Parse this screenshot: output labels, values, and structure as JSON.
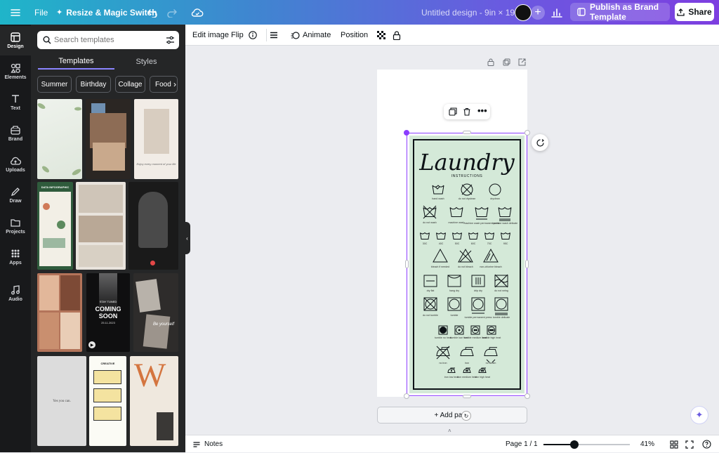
{
  "topbar": {
    "file_label": "File",
    "resize_label": "Resize & Magic Switch",
    "doc_title": "Untitled design - 9in × 19.5in",
    "publish_label": "Publish as Brand Template",
    "share_label": "Share"
  },
  "rail": {
    "items": [
      {
        "label": "Design",
        "icon": "design-icon"
      },
      {
        "label": "Elements",
        "icon": "elements-icon"
      },
      {
        "label": "Text",
        "icon": "text-icon"
      },
      {
        "label": "Brand",
        "icon": "brand-icon"
      },
      {
        "label": "Uploads",
        "icon": "uploads-icon"
      },
      {
        "label": "Draw",
        "icon": "draw-icon"
      },
      {
        "label": "Projects",
        "icon": "projects-icon"
      },
      {
        "label": "Apps",
        "icon": "apps-icon"
      },
      {
        "label": "Audio",
        "icon": "audio-icon"
      }
    ]
  },
  "panel": {
    "search_placeholder": "Search templates",
    "tabs": [
      "Templates",
      "Styles"
    ],
    "chips": [
      "Summer",
      "Birthday",
      "Collage",
      "Food"
    ],
    "thumb_texts": {
      "infographic": "DATA INFOGRAPHIC",
      "stay_tuned": "STAY TUNED",
      "coming": "COMING",
      "soon": "SOON",
      "coming_date": "25.11.2023",
      "yes_you_can": "Yes you can.",
      "creative": "CREATIVE",
      "letter": "W",
      "script_quote": "Enjoy every moment of your life",
      "be_yourself": "Be yourself"
    }
  },
  "toolbar": {
    "edit_image": "Edit image",
    "flip": "Flip",
    "animate": "Animate",
    "position": "Position"
  },
  "poster": {
    "title": "Laundry",
    "subtitle": "INSTRUCTIONS",
    "labels": {
      "handwash": "hand wash",
      "do_not_dryclean": "do not dryclean",
      "dryclean": "dryclean",
      "do_not_wash": "do not wash",
      "machine_wash": "machine wash",
      "machine_wash_perm": "machine wash permanent press",
      "machine_wash_delicate": "machine wash delicate",
      "t30": "30C",
      "t40": "40C",
      "t50": "50C",
      "t60": "60C",
      "t70": "70C",
      "t95": "95C",
      "bleach_if_needed": "bleach if needed",
      "do_not_bleach": "do not bleach",
      "non_chlorine": "non-chlorine bleach",
      "dry_flat": "dry flat",
      "hang_dry": "hang dry",
      "drip_dry": "drip dry",
      "do_not_wring": "do not wring",
      "do_not_tumble": "do not tumble",
      "tumble": "tumble",
      "tumble_perm": "tumble permanent press",
      "tumble_delicate": "tumble delicate",
      "tumble_no_heat": "tumble no heat",
      "tumble_low": "tumble low heat",
      "tumble_medium": "tumble medium heat",
      "tumble_high": "tumble high heat",
      "no_iron": "no iron",
      "iron": "iron",
      "no_steam": "no steam",
      "iron_low": "iron low heat",
      "iron_medium": "iron medium heat",
      "iron_high": "iron high heat"
    }
  },
  "canvas": {
    "add_page_label": "+ Add page"
  },
  "footer": {
    "notes_label": "Notes",
    "page_indicator": "Page 1 / 1",
    "zoom_level": 0.41,
    "zoom_text": "41%"
  },
  "colors": {
    "accent": "#8b3dff",
    "poster_bg": "#d4e9d8",
    "panel_bg": "#252627",
    "rail_bg": "#18191b"
  }
}
